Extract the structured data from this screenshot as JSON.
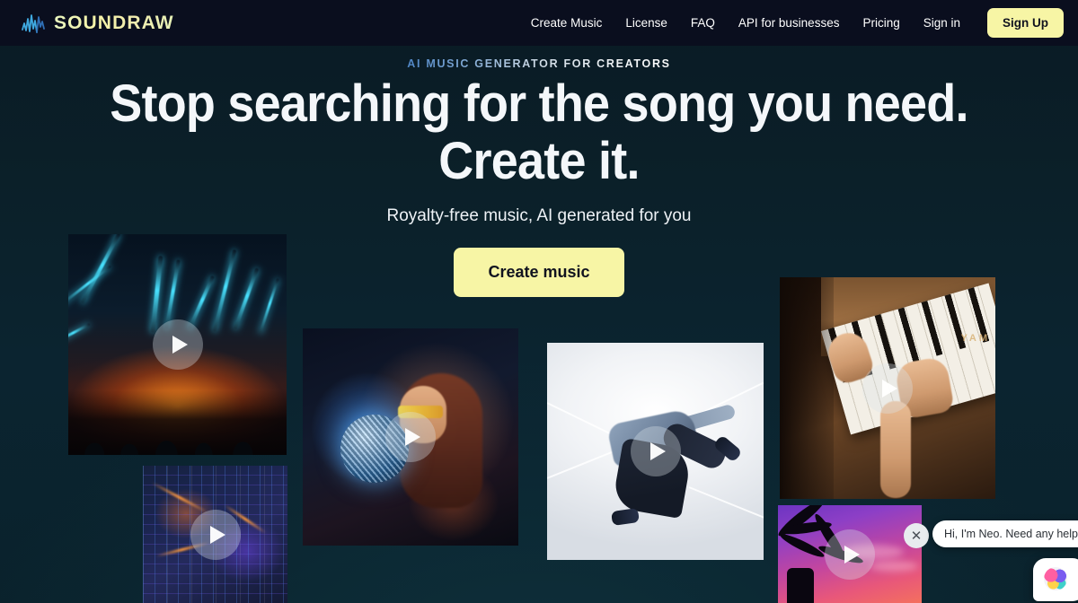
{
  "brand": {
    "name": "SOUNDRAW",
    "logo_icon": "waveform-icon",
    "accent_yellow": "#f7f5a5",
    "page_bg": "#0b2029",
    "header_bg": "#0a0e1e"
  },
  "nav": {
    "items": [
      {
        "label": "Create Music"
      },
      {
        "label": "License"
      },
      {
        "label": "FAQ"
      },
      {
        "label": "API for businesses"
      },
      {
        "label": "Pricing"
      },
      {
        "label": "Sign in"
      }
    ],
    "signup_label": "Sign Up"
  },
  "hero": {
    "eyebrow": "AI MUSIC GENERATOR FOR CREATORS",
    "headline_line1": "Stop searching for the song you need.",
    "headline_line2": "Create it.",
    "subtitle": "Royalty-free music, AI generated for you",
    "cta_label": "Create music"
  },
  "cards": [
    {
      "name": "concert-lasers",
      "play_icon": "play-icon"
    },
    {
      "name": "city-night",
      "play_icon": "play-icon"
    },
    {
      "name": "disco-ball-woman",
      "play_icon": "play-icon"
    },
    {
      "name": "breakdancer",
      "play_icon": "play-icon"
    },
    {
      "name": "piano-hands",
      "play_icon": "play-icon",
      "brand_text": "YAM"
    },
    {
      "name": "palm-sunset",
      "play_icon": "play-icon"
    }
  ],
  "chat": {
    "message": "Hi, I'm Neo. Need any help?",
    "close_icon": "close-icon",
    "launcher_icon": "brain-icon"
  }
}
